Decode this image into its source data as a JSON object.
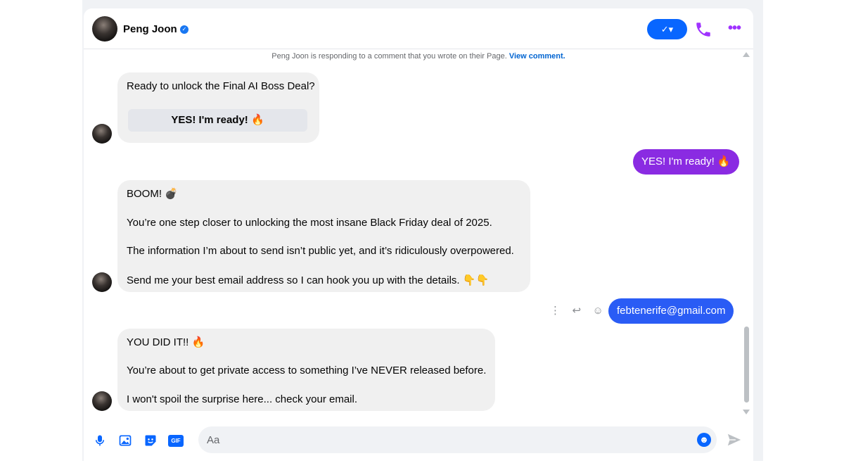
{
  "header": {
    "contact_name": "Peng Joon",
    "verified_mark": "✓",
    "action_pill_label": "✓▾",
    "more_label": "•••"
  },
  "notice": {
    "text": "Peng Joon is responding to a comment that you wrote on their Page.",
    "link_label": "View comment."
  },
  "messages": {
    "m1": {
      "text": "Ready to unlock the Final AI Boss Deal?",
      "quick_reply": "YES! I'm ready! 🔥"
    },
    "m2": {
      "text": "YES! I'm ready! 🔥"
    },
    "m3": {
      "line1": "BOOM! 💣",
      "line2": "You’re one step closer to unlocking the most insane Black Friday deal of 2025.",
      "line3": "The information I’m about to send isn’t public yet, and it’s ridiculously overpowered.",
      "line4": "Send me your best email address so I can hook you up with the details. 👇👇"
    },
    "m4": {
      "text": "febtenerife@gmail.com"
    },
    "m5": {
      "line1": "YOU DID IT!! 🔥",
      "line2": "You’re about to get private access to something I’ve NEVER released before.",
      "line3": "I won't spoil the surprise here... check your email."
    }
  },
  "message_tools": {
    "more": "⋮",
    "reply": "↩",
    "react": "☺"
  },
  "composer": {
    "placeholder": "Aa",
    "gif_label": "GIF",
    "emoji_label": "☻",
    "mic_icon": "mic-icon",
    "image_icon": "image-icon",
    "sticker_icon": "sticker-icon"
  },
  "colors": {
    "accent_blue": "#0866ff",
    "outgoing_purple": "#8a2be2",
    "outgoing_blue": "#2a5cf5",
    "more_purple": "#a033ff"
  }
}
